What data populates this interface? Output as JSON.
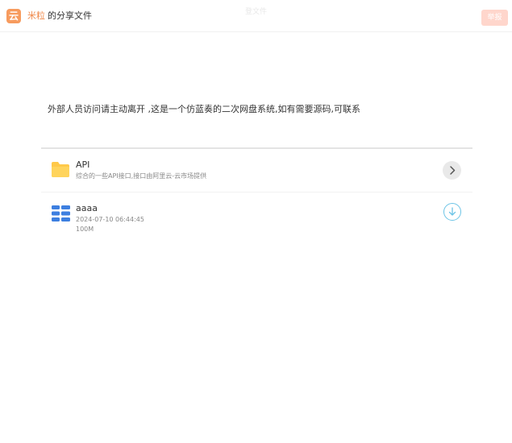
{
  "header": {
    "logo_char": "云",
    "brand": "米粒",
    "subtitle": "的分享文件",
    "center_text": "登文件",
    "action_label": "举报"
  },
  "notice": "外部人员访问请主动离开 ,这是一个仿蓝奏的二次网盘系统,如有需要源码,可联系",
  "items": [
    {
      "type": "folder",
      "icon": "folder-icon",
      "name": "API",
      "description": "综合的一些API接口,接口由阿里云-云市场提供",
      "action_icon": "chevron-right-icon"
    },
    {
      "type": "file",
      "icon": "archive-file-icon",
      "name": "aaaa",
      "date": "2024-07-10 06:44:45",
      "size": "100M",
      "action_icon": "download-icon"
    }
  ],
  "colors": {
    "brand": "#f08a4b",
    "logo_bg": "#f79b5e",
    "action_bg": "#ffd6cc",
    "folder": "#ffc94a",
    "file_icon": "#3d7fe0",
    "download_ring": "#6cc4e6"
  }
}
